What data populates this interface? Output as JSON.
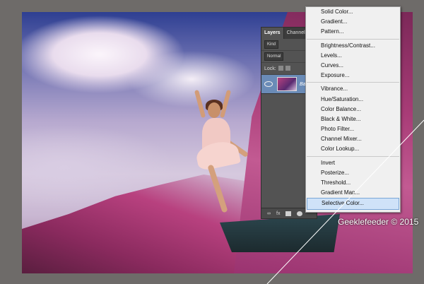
{
  "photo": {
    "watermark": "Geeklefeeder © 2015"
  },
  "layers_panel": {
    "tabs": [
      "Layers",
      "Channels"
    ],
    "filter_kind": "Kind",
    "blend_mode": "Normal",
    "lock_label": "Lock:",
    "layer_name": "Bac",
    "footer_links": "fx"
  },
  "adjustment_menu": {
    "groups": [
      [
        "Solid Color...",
        "Gradient...",
        "Pattern..."
      ],
      [
        "Brightness/Contrast...",
        "Levels...",
        "Curves...",
        "Exposure..."
      ],
      [
        "Vibrance...",
        "Hue/Saturation...",
        "Color Balance...",
        "Black & White...",
        "Photo Filter...",
        "Channel Mixer...",
        "Color Lookup..."
      ],
      [
        "Invert",
        "Posterize...",
        "Threshold...",
        "Gradient Map...",
        "Selective Color..."
      ]
    ],
    "selected": "Selective Color..."
  },
  "colors": {
    "background": "#6e6b69",
    "menu_bg": "#f0f0f0",
    "menu_highlight": "#cfe2f8",
    "panel_bg": "#535353",
    "layer_selected": "#6a8bb7"
  }
}
